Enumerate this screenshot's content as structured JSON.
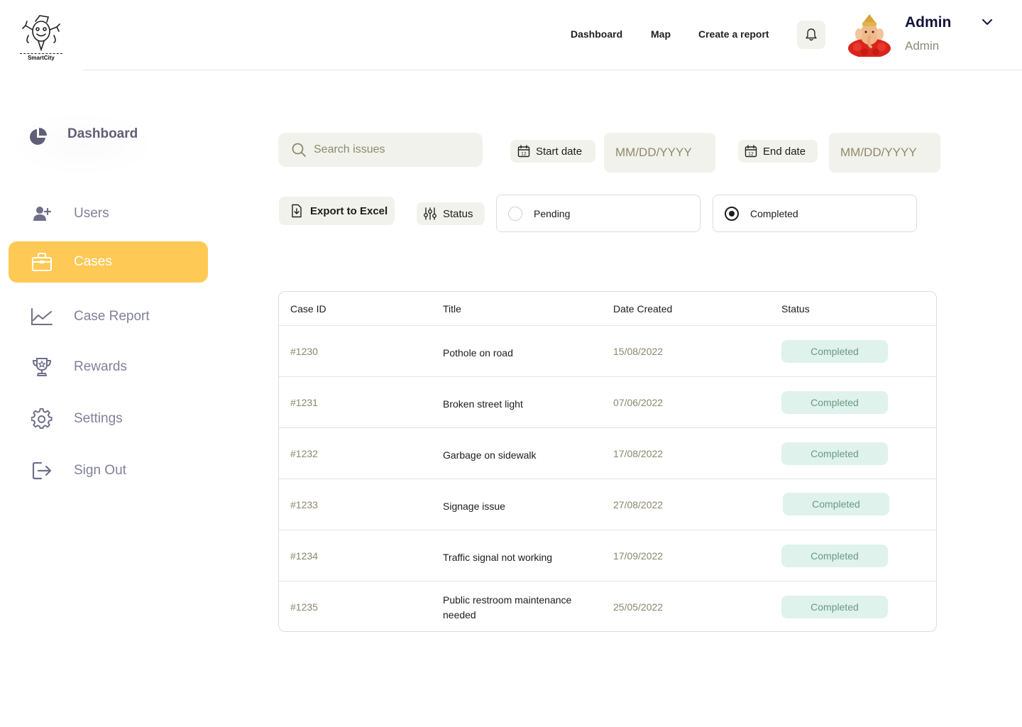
{
  "brand": {
    "logo_text": "SmartCity"
  },
  "header": {
    "nav": [
      "Dashboard",
      "Map",
      "Create a report"
    ],
    "user": {
      "name": "Admin",
      "role": "Admin"
    }
  },
  "sidebar": {
    "items": [
      {
        "label": "Dashboard",
        "icon": "pie-chart-icon"
      },
      {
        "label": "Users",
        "icon": "add-user-icon"
      },
      {
        "label": "Cases",
        "icon": "briefcase-icon",
        "active": true
      },
      {
        "label": "Case Report",
        "icon": "line-chart-icon"
      },
      {
        "label": "Rewards",
        "icon": "trophy-icon"
      },
      {
        "label": "Settings",
        "icon": "gear-icon"
      },
      {
        "label": "Sign Out",
        "icon": "sign-out-icon"
      }
    ]
  },
  "filters": {
    "search_placeholder": "Search  issues",
    "start_date_label": "Start date",
    "start_date_placeholder": "MM/DD/YYYY",
    "end_date_label": "End date",
    "end_date_placeholder": "MM/DD/YYYY",
    "export_label": "Export to Excel",
    "status_label": "Status",
    "status_options": [
      {
        "label": "Pending",
        "selected": false
      },
      {
        "label": "Completed",
        "selected": true
      }
    ]
  },
  "table": {
    "headers": [
      "Case ID",
      "Title",
      "Date Created",
      "Status"
    ],
    "rows": [
      {
        "id": "#1230",
        "title": "Pothole on road",
        "date": "15/08/2022",
        "status": "Completed"
      },
      {
        "id": "#1231",
        "title": "Broken street light",
        "date": "07/06/2022",
        "status": "Completed"
      },
      {
        "id": "#1232",
        "title": "Garbage on sidewalk",
        "date": "17/08/2022",
        "status": "Completed"
      },
      {
        "id": "#1233",
        "title": "Signage issue",
        "date": "27/08/2022",
        "status": "Completed"
      },
      {
        "id": "#1234",
        "title": "Traffic signal not working",
        "date": "17/09/2022",
        "status": "Completed"
      },
      {
        "id": "#1235",
        "title": "Public restroom maintenance needed",
        "date": "25/05/2022",
        "status": "Completed"
      }
    ]
  },
  "colors": {
    "accent": "#fec955",
    "panel_bg": "#f2f2ec",
    "badge_bg": "#dff2ec",
    "badge_text": "#6b9a84",
    "muted_text": "#8a876a",
    "sidebar_text": "#80819a"
  }
}
